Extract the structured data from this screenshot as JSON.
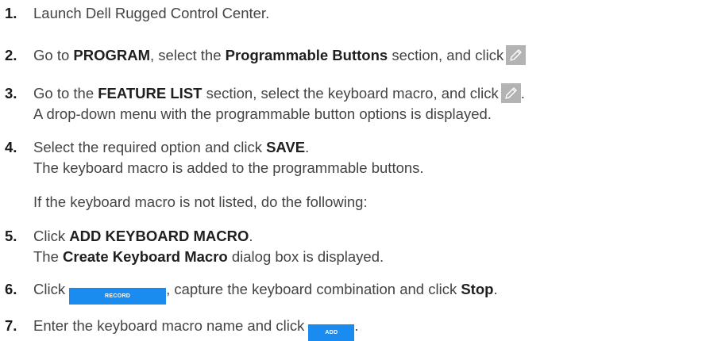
{
  "steps": [
    {
      "number": "1.",
      "parts": {
        "a": "Launch Dell Rugged Control Center."
      }
    },
    {
      "number": "2.",
      "parts": {
        "a": "Go to ",
        "b": "PROGRAM",
        "c": ", select the ",
        "d": "Programmable Buttons",
        "e": " section, and click"
      },
      "icon": "pencil-edit-icon"
    },
    {
      "number": "3.",
      "parts": {
        "a": "Go to the ",
        "b": "FEATURE LIST",
        "c": " section, select the keyboard macro, and click",
        "d": "."
      },
      "icon": "pencil-edit-icon",
      "result": "A drop-down menu with the programmable button options is displayed."
    },
    {
      "number": "4.",
      "parts": {
        "a": "Select the required option and click ",
        "b": "SAVE",
        "c": "."
      },
      "result": "The keyboard macro is added to the programmable buttons."
    },
    {
      "number": "5.",
      "parts": {
        "a": "Click ",
        "b": "ADD KEYBOARD MACRO",
        "c": "."
      },
      "result_parts": {
        "a": "The ",
        "b": "Create Keyboard Macro",
        "c": " dialog box is displayed."
      }
    },
    {
      "number": "6.",
      "parts": {
        "a": "Click",
        "b": ", capture the keyboard combination and click ",
        "c": "Stop",
        "d": "."
      },
      "button_label": "RECORD"
    },
    {
      "number": "7.",
      "parts": {
        "a": "Enter the keyboard macro name and click",
        "b": "."
      },
      "button_label": "ADD"
    }
  ],
  "note": "If the keyboard macro is not listed, do the following:",
  "colors": {
    "text": "#444444",
    "button_blue": "#1a8cf0",
    "icon_button_gray": "#b3b3b3"
  }
}
